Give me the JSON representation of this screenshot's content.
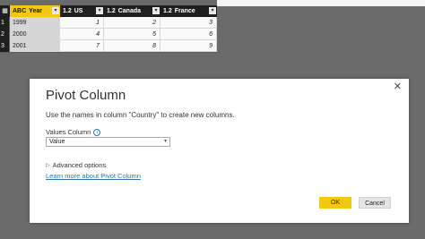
{
  "grid": {
    "columns": [
      {
        "type": "ABC",
        "name": "Year"
      },
      {
        "type": "1.2",
        "name": "US"
      },
      {
        "type": "1.2",
        "name": "Canada"
      },
      {
        "type": "1.2",
        "name": "France"
      }
    ],
    "rows": [
      {
        "num": "1",
        "year": "1999",
        "us": "1",
        "canada": "2",
        "france": "3"
      },
      {
        "num": "2",
        "year": "2000",
        "us": "4",
        "canada": "5",
        "france": "6"
      },
      {
        "num": "3",
        "year": "2001",
        "us": "7",
        "canada": "8",
        "france": "9"
      }
    ]
  },
  "dialog": {
    "title": "Pivot Column",
    "description": "Use the names in column \"Country\" to create new columns.",
    "values_label": "Values Column",
    "values_selected": "Value",
    "advanced_label": "Advanced options",
    "learn_more": "Learn more about Pivot Column",
    "ok_label": "OK",
    "cancel_label": "Cancel"
  },
  "colors": {
    "accent": "#f2c811",
    "link": "#2e75b6"
  }
}
